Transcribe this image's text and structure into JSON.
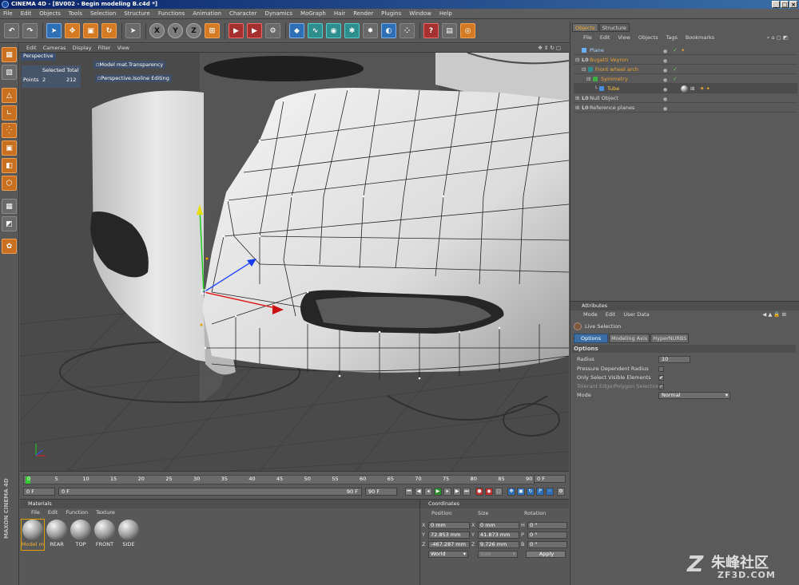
{
  "window": {
    "title": "CINEMA 4D - [BV002 - Begin modeling B.c4d *]"
  },
  "menubar": [
    "File",
    "Edit",
    "Objects",
    "Tools",
    "Selection",
    "Structure",
    "Functions",
    "Animation",
    "Character",
    "Dynamics",
    "MoGraph",
    "Hair",
    "Render",
    "Plugins",
    "Window",
    "Help"
  ],
  "toolbar": {
    "x": "X",
    "y": "Y",
    "z": "Z"
  },
  "viewport": {
    "menu": [
      "Edit",
      "Cameras",
      "Display",
      "Filter",
      "View"
    ],
    "label": "Perspective",
    "hud": {
      "header": "Selected Total",
      "points_label": "Points",
      "selected": "2",
      "total": "212",
      "mat_transparency": "Model mat.Transparency",
      "isoline": "Perspective.Isoline Editing"
    }
  },
  "timeline": {
    "ticks": [
      "0",
      "5",
      "10",
      "15",
      "20",
      "25",
      "30",
      "35",
      "40",
      "45",
      "50",
      "55",
      "60",
      "65",
      "70",
      "75",
      "80",
      "85",
      "90"
    ],
    "current_frame": "0 F",
    "start": "0 F",
    "range_start": "0 F",
    "range_end": "90 F",
    "end": "90 F"
  },
  "materials": {
    "title": "Materials",
    "menu": [
      "File",
      "Edit",
      "Function",
      "Texture"
    ],
    "items": [
      "Model m",
      "REAR",
      "TOP",
      "FRONT",
      "SIDE"
    ]
  },
  "coordinates": {
    "title": "Coordinates",
    "headers": [
      "Position",
      "Size",
      "Rotation"
    ],
    "rows": [
      {
        "axis": "X",
        "pos": "0 mm",
        "saxis": "X",
        "size": "0 mm",
        "raxis": "H",
        "rot": "0 °"
      },
      {
        "axis": "Y",
        "pos": "72.853 mm",
        "saxis": "Y",
        "size": "41.873 mm",
        "raxis": "P",
        "rot": "0 °"
      },
      {
        "axis": "Z",
        "pos": "-467.287 mm",
        "saxis": "Z",
        "size": "9.726 mm",
        "raxis": "B",
        "rot": "0 °"
      }
    ],
    "space": "World",
    "size_mode": "Size",
    "apply": "Apply",
    "brand": "MAXON CINEMA 4D"
  },
  "objects": {
    "tabs": [
      "Objects",
      "Structure"
    ],
    "menu": [
      "File",
      "Edit",
      "View",
      "Objects",
      "Tags",
      "Bookmarks"
    ],
    "items": [
      {
        "name": "Plane",
        "color": "#a8d0ff"
      },
      {
        "name": "Bugatti Veyron",
        "color": "#e6a030"
      },
      {
        "name": "Front wheel arch",
        "color": "#e6a030"
      },
      {
        "name": "Symmetry",
        "color": "#e6a030"
      },
      {
        "name": "Tube",
        "color": "#ffc040"
      },
      {
        "name": "Null Object",
        "color": "#d8d8d8"
      },
      {
        "name": "Reference planes",
        "color": "#d8d8d8"
      }
    ]
  },
  "attributes": {
    "title": "Attributes",
    "menu": [
      "Mode",
      "Edit",
      "User Data"
    ],
    "tool": "Live Selection",
    "tabs": [
      "Options",
      "Modeling Axis",
      "HyperNURBS"
    ],
    "section": "Options",
    "radius_label": "Radius",
    "radius_value": "10",
    "pressure_label": "Pressure Dependent Radius",
    "visible_label": "Only Select Visible Elements",
    "visible_check": "✔",
    "tolerant_label": "Tolerant Edge/Polygon Selection",
    "tolerant_check": "✔",
    "mode_label": "Mode",
    "mode_value": "Normal"
  },
  "watermark": {
    "brand": "朱峰社区",
    "url": "ZF3D.COM"
  }
}
